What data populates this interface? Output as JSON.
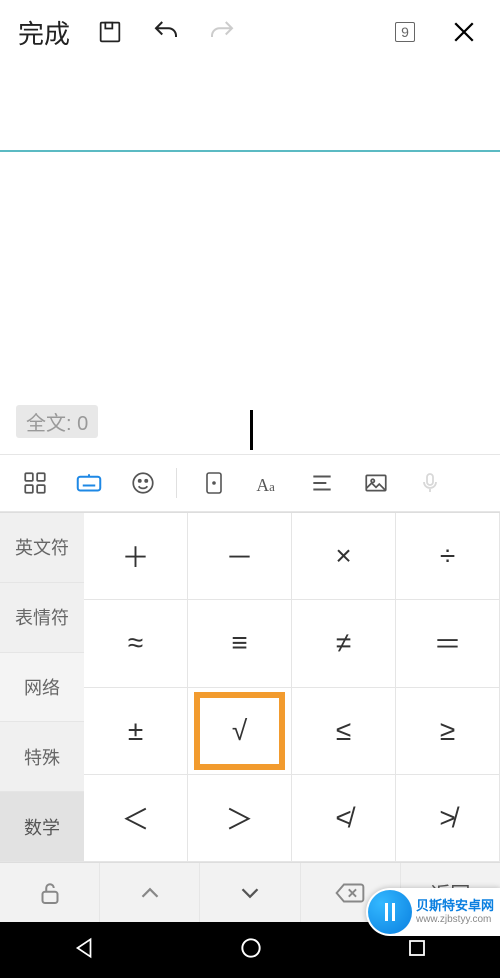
{
  "topbar": {
    "done_label": "完成",
    "page_number": "9"
  },
  "editor": {
    "wordcount_label": "全文: 0"
  },
  "categories": {
    "items": [
      {
        "label": "英文符"
      },
      {
        "label": "表情符"
      },
      {
        "label": "网络"
      },
      {
        "label": "特殊"
      },
      {
        "label": "数学",
        "active": true
      }
    ]
  },
  "keys": [
    "＋",
    "－",
    "×",
    "÷",
    "≈",
    "≡",
    "≠",
    "＝",
    "±",
    "√",
    "≤",
    "≥",
    "＜",
    "＞",
    "≮",
    "≯"
  ],
  "highlight_index": 9,
  "kb_bottom": {
    "back_label": "返回"
  },
  "watermark": {
    "line1": "贝斯特安卓网",
    "line2": "www.zjbstyy.com"
  }
}
